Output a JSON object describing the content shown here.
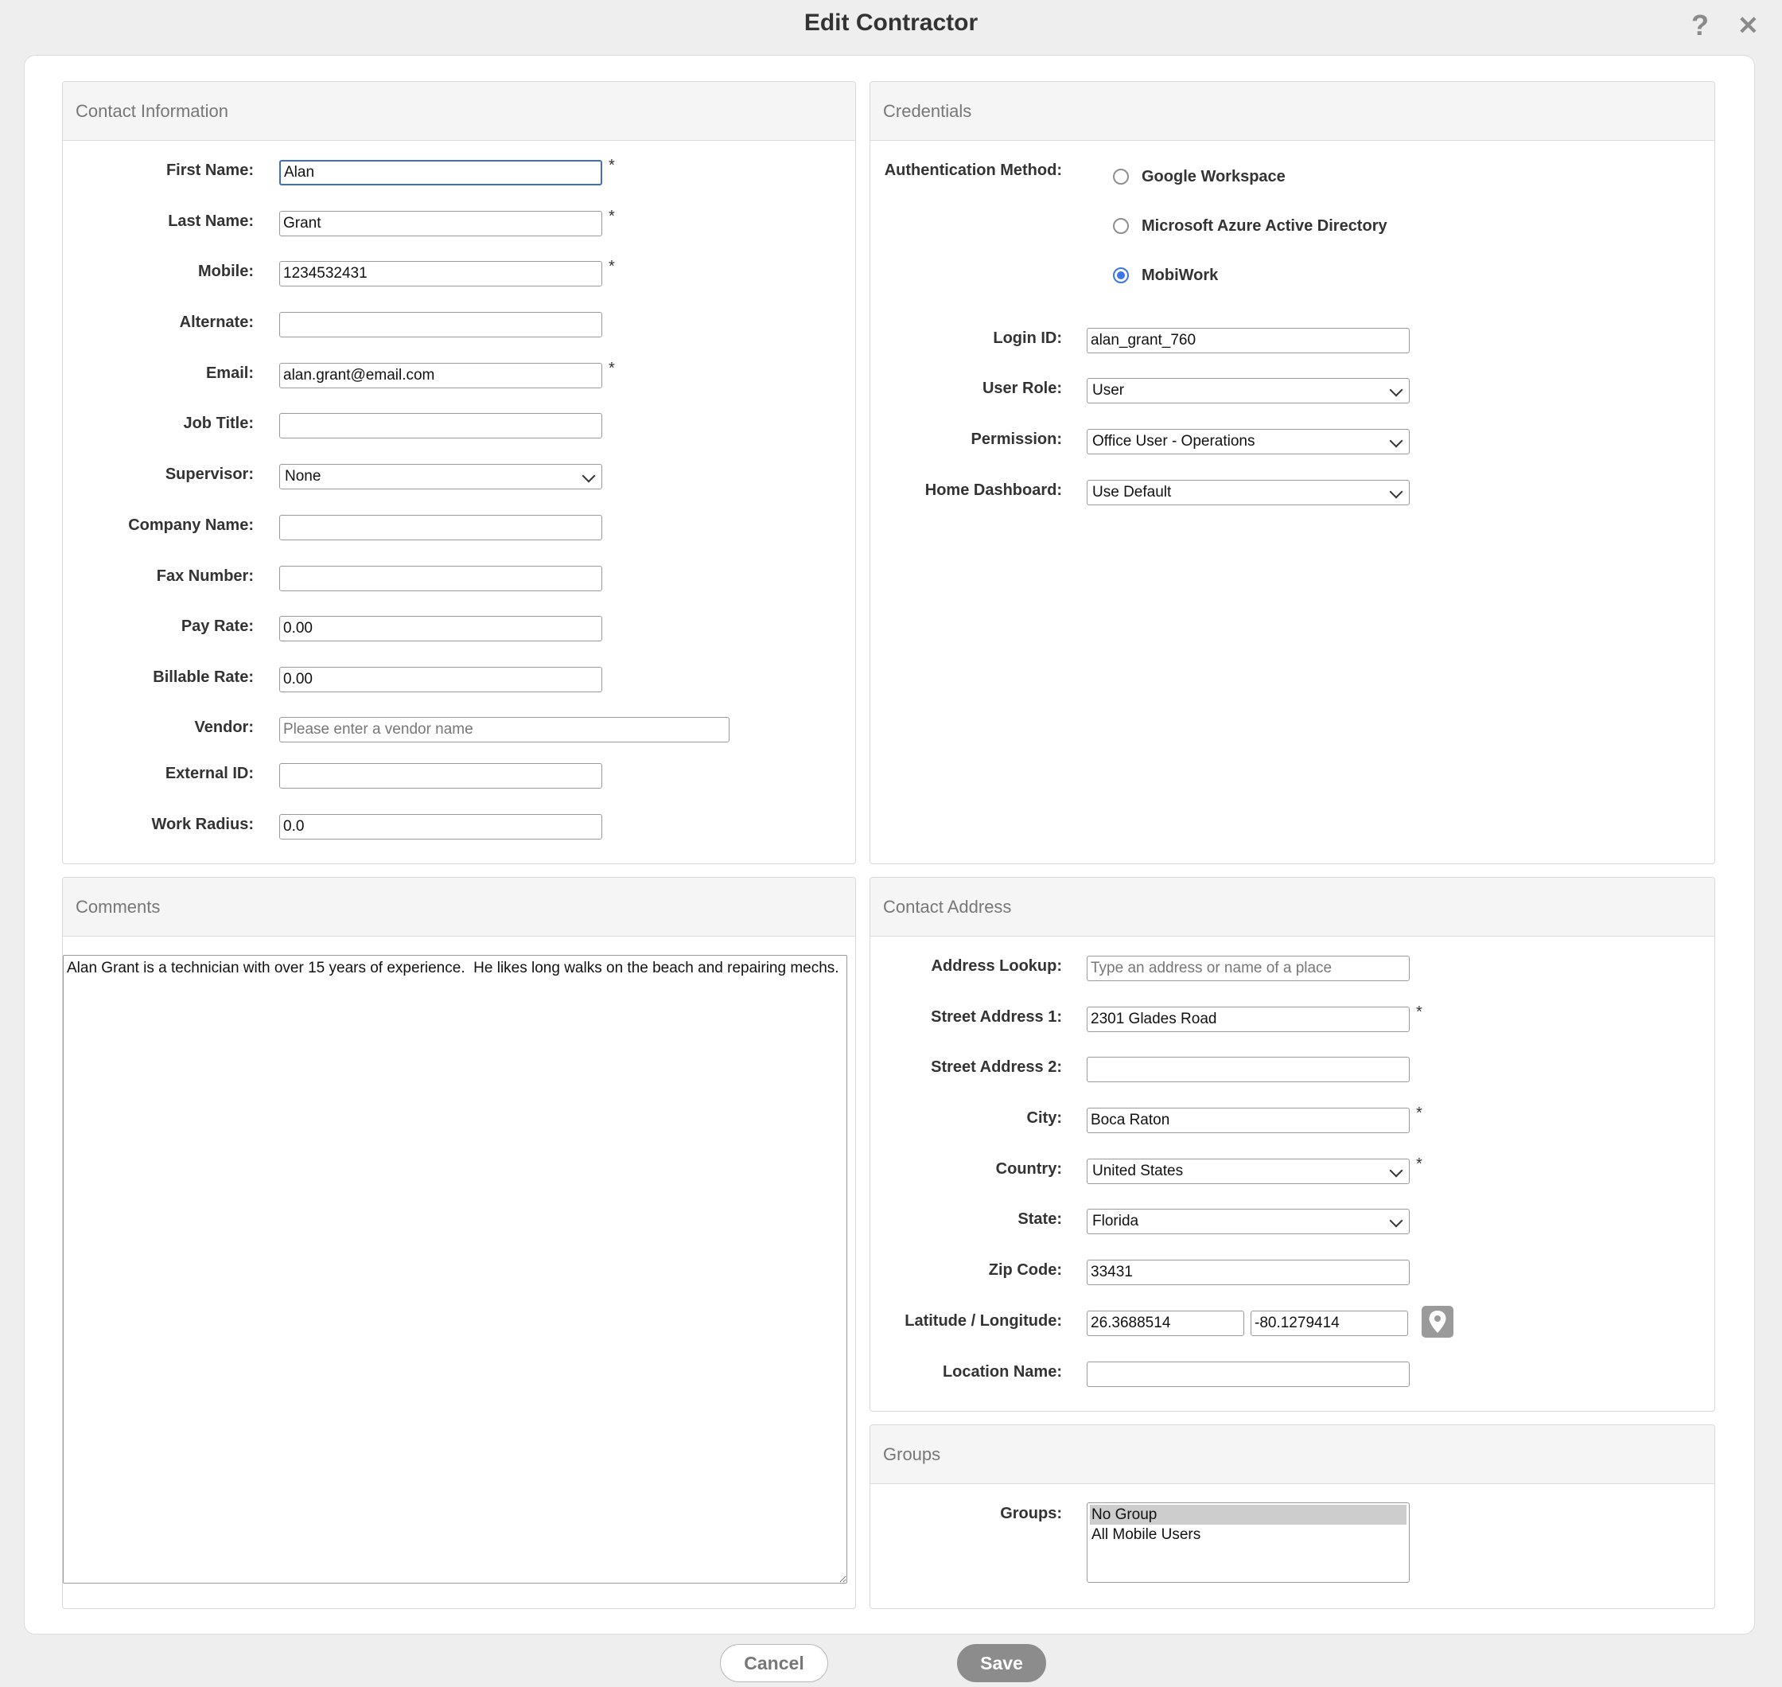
{
  "dialog": {
    "title": "Edit Contractor",
    "help_icon": "?",
    "close_icon": "✕"
  },
  "contact": {
    "heading": "Contact Information",
    "first_name": {
      "label": "First Name:",
      "value": "Alan",
      "required": "*"
    },
    "last_name": {
      "label": "Last Name:",
      "value": "Grant",
      "required": "*"
    },
    "mobile": {
      "label": "Mobile:",
      "value": "1234532431",
      "required": "*"
    },
    "alternate": {
      "label": "Alternate:",
      "value": ""
    },
    "email": {
      "label": "Email:",
      "value": "alan.grant@email.com",
      "required": "*"
    },
    "job_title": {
      "label": "Job Title:",
      "value": ""
    },
    "supervisor": {
      "label": "Supervisor:",
      "value": "None"
    },
    "company_name": {
      "label": "Company Name:",
      "value": ""
    },
    "fax_number": {
      "label": "Fax Number:",
      "value": ""
    },
    "pay_rate": {
      "label": "Pay Rate:",
      "value": "0.00"
    },
    "billable_rate": {
      "label": "Billable Rate:",
      "value": "0.00"
    },
    "vendor": {
      "label": "Vendor:",
      "value": "",
      "placeholder": "Please enter a vendor name"
    },
    "external_id": {
      "label": "External ID:",
      "value": ""
    },
    "work_radius": {
      "label": "Work Radius:",
      "value": "0.0"
    }
  },
  "credentials": {
    "heading": "Credentials",
    "auth_label": "Authentication Method:",
    "auth_options": [
      "Google Workspace",
      "Microsoft Azure Active Directory",
      "MobiWork"
    ],
    "auth_selected": "MobiWork",
    "login_id": {
      "label": "Login ID:",
      "value": "alan_grant_760"
    },
    "user_role": {
      "label": "User Role:",
      "value": "User"
    },
    "permission": {
      "label": "Permission:",
      "value": "Office User - Operations"
    },
    "home_dashboard": {
      "label": "Home Dashboard:",
      "value": "Use Default"
    }
  },
  "comments": {
    "heading": "Comments",
    "text": "Alan Grant is a technician with over 15 years of experience.  He likes long walks on the beach and repairing mechs."
  },
  "address": {
    "heading": "Contact Address",
    "lookup": {
      "label": "Address Lookup:",
      "placeholder": "Type an address or name of a place"
    },
    "street1": {
      "label": "Street Address 1:",
      "value": "2301 Glades Road",
      "required": "*"
    },
    "street2": {
      "label": "Street Address 2:",
      "value": ""
    },
    "city": {
      "label": "City:",
      "value": "Boca Raton",
      "required": "*"
    },
    "country": {
      "label": "Country:",
      "value": "United States",
      "required": "*"
    },
    "state": {
      "label": "State:",
      "value": "Florida"
    },
    "zip": {
      "label": "Zip Code:",
      "value": "33431"
    },
    "latlng": {
      "label": "Latitude / Longitude:",
      "lat": "26.3688514",
      "lng": "-80.1279414"
    },
    "location_name": {
      "label": "Location Name:",
      "value": ""
    }
  },
  "groups": {
    "heading": "Groups",
    "label": "Groups:",
    "options": [
      "No Group",
      "All Mobile Users"
    ],
    "selected": "No Group"
  },
  "footer": {
    "cancel_label": "Cancel",
    "save_label": "Save"
  }
}
